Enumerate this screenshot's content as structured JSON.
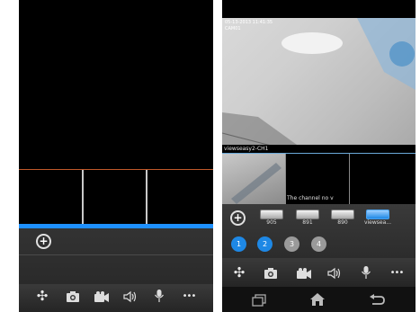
{
  "left_screen": {
    "add_label": "+",
    "toolbar": {
      "ptz_icon": "✣",
      "snapshot_icon": "camera-icon",
      "record_icon": "video-record-icon",
      "audio_icon": "speaker-icon",
      "mic_icon": "microphone-icon",
      "more_label": "•••"
    }
  },
  "right_screen": {
    "status_bar": "05-13-2013 11:41:35",
    "overlay_label": "CAM01",
    "channel_label": "viewseasy2-CH1",
    "no_video_text": "The channel no v",
    "add_label": "+",
    "cameras": [
      {
        "label": "905"
      },
      {
        "label": "891"
      },
      {
        "label": "890"
      },
      {
        "label": "viewsea..."
      }
    ],
    "pages": [
      "1",
      "2",
      "3",
      "4"
    ],
    "toolbar": {
      "ptz_icon": "✣",
      "more_label": "•••"
    },
    "nav": {
      "recent_icon": "recent-apps-icon",
      "home_icon": "home-icon",
      "back_icon": "back-icon"
    }
  },
  "colors": {
    "accent_blue": "#1e90ff",
    "divider_orange": "#c0582a",
    "page_dot_active": "#1e88e5",
    "page_dot_inactive": "#9a9a9a"
  }
}
